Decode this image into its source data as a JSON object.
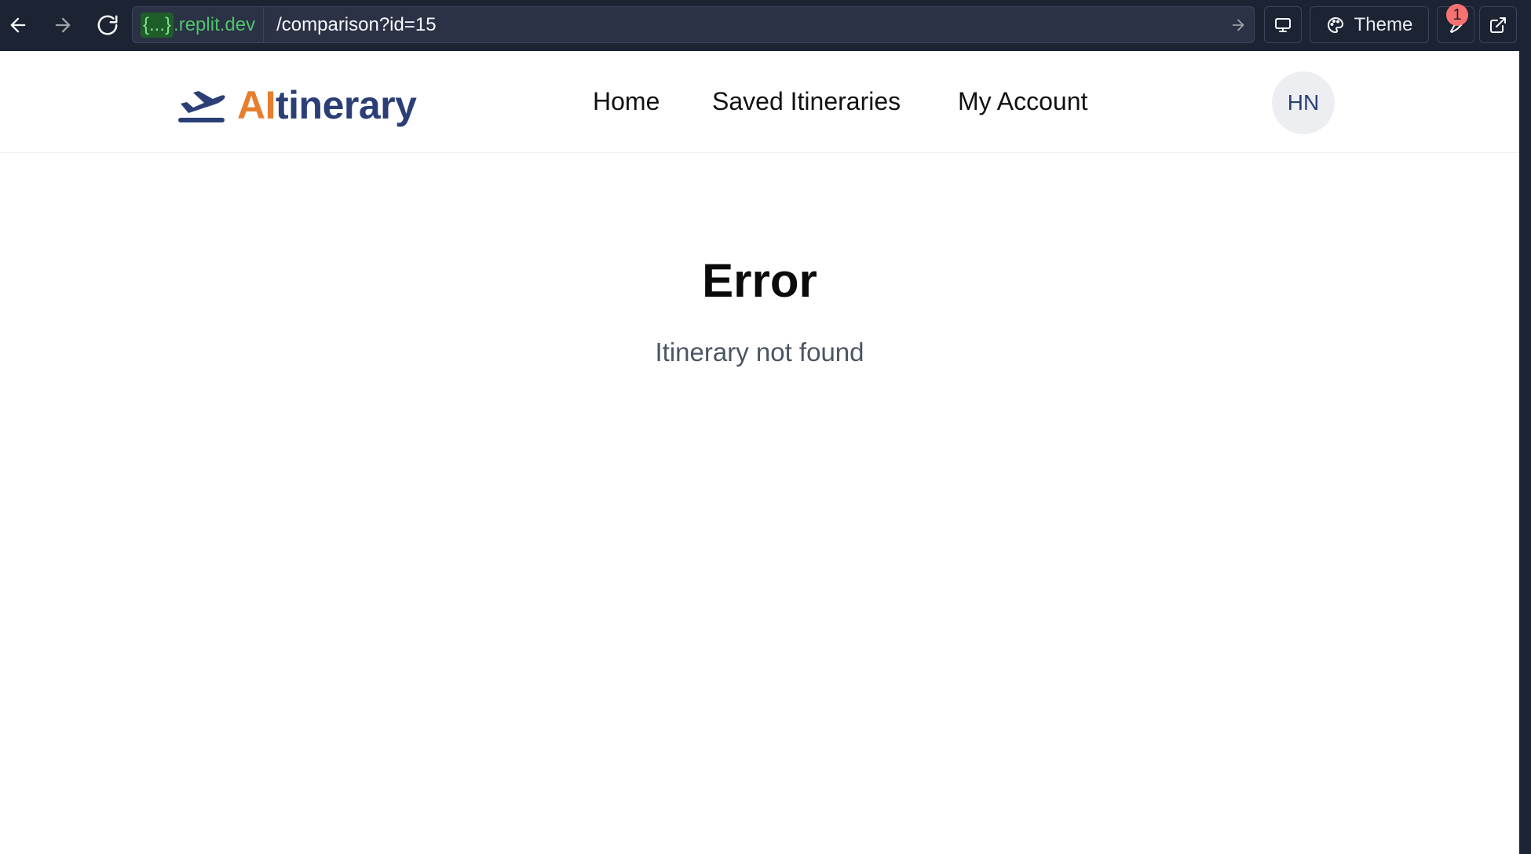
{
  "browser": {
    "url_host_braces": "{...}",
    "url_host_domain": ".replit.dev",
    "url_path": "/comparison?id=15",
    "theme_label": "Theme",
    "notification_count": "1"
  },
  "header": {
    "logo_part1": "AI",
    "logo_part2": "tinerary",
    "nav": {
      "home": "Home",
      "saved": "Saved Itineraries",
      "account": "My Account"
    },
    "avatar_initials": "HN"
  },
  "main": {
    "error_title": "Error",
    "error_message": "Itinerary not found"
  },
  "colors": {
    "accent_orange": "#e67e2e",
    "brand_navy": "#2b3f76",
    "browser_bg": "#1c2333",
    "badge_red": "#f87171"
  },
  "icons": [
    "back-arrow-icon",
    "forward-arrow-icon",
    "reload-icon",
    "go-arrow-icon",
    "monitor-icon",
    "palette-icon",
    "wrench-icon",
    "external-link-icon",
    "airplane-takeoff-icon"
  ]
}
